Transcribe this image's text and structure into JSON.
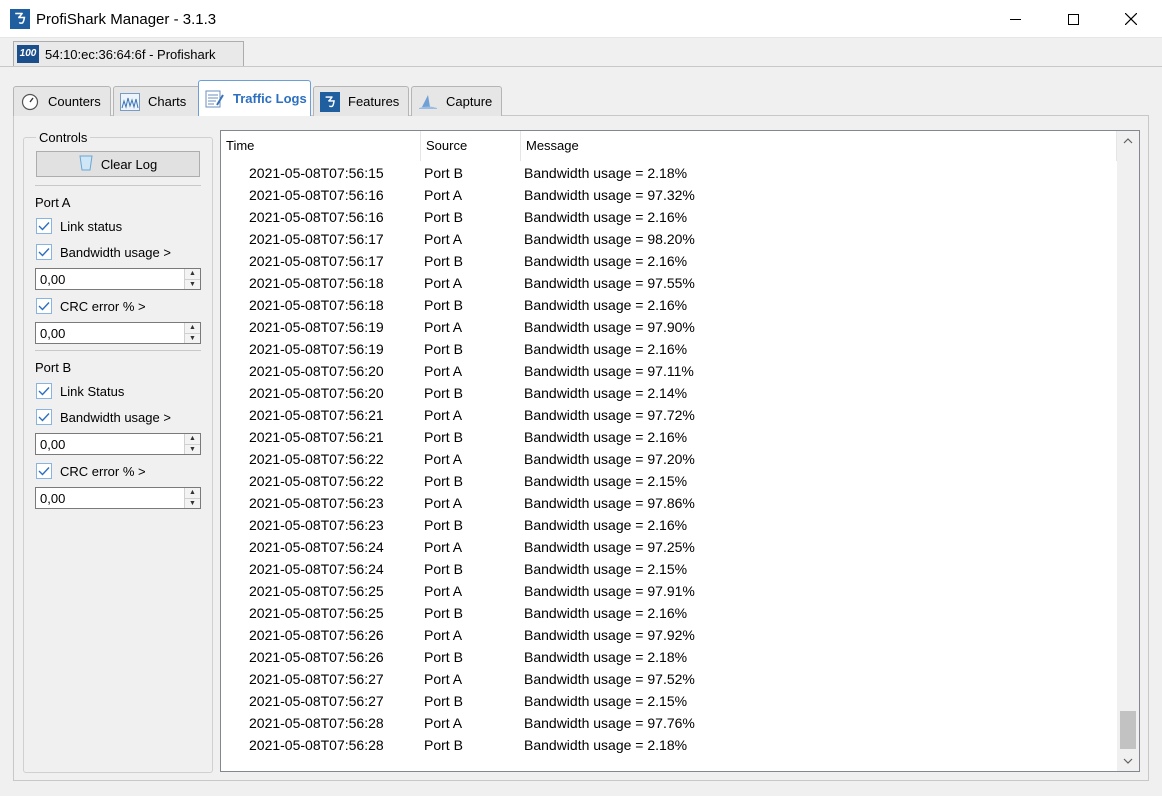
{
  "window": {
    "title": "ProfiShark Manager - 3.1.3",
    "icon": "profishark-logo-icon"
  },
  "device": {
    "badge": "100",
    "label": "54:10:ec:36:64:6f - Profishark"
  },
  "tabs": [
    {
      "label": "Counters",
      "icon": "gauge-icon",
      "active": false
    },
    {
      "label": "Charts",
      "icon": "chart-icon",
      "active": false
    },
    {
      "label": "Traffic Logs",
      "icon": "log-icon",
      "active": true
    },
    {
      "label": "Features",
      "icon": "profishark-logo-icon",
      "active": false
    },
    {
      "label": "Capture",
      "icon": "shark-fin-icon",
      "active": false
    }
  ],
  "controls": {
    "legend": "Controls",
    "clear_label": "Clear Log",
    "port_a": {
      "title": "Port A",
      "link_label": "Link status",
      "link_checked": true,
      "bandwidth_label": "Bandwidth usage >",
      "bandwidth_checked": true,
      "bandwidth_value": "0,00",
      "crc_label": "CRC error % >",
      "crc_checked": true,
      "crc_value": "0,00"
    },
    "port_b": {
      "title": "Port B",
      "link_label": "Link Status",
      "link_checked": true,
      "bandwidth_label": "Bandwidth usage >",
      "bandwidth_checked": true,
      "bandwidth_value": "0,00",
      "crc_label": "CRC error % >",
      "crc_checked": true,
      "crc_value": "0,00"
    }
  },
  "log": {
    "columns": [
      "Time",
      "Source",
      "Message"
    ],
    "rows": [
      [
        "2021-05-08T07:56:15",
        "Port B",
        "Bandwidth usage = 2.18%"
      ],
      [
        "2021-05-08T07:56:16",
        "Port A",
        "Bandwidth usage = 97.32%"
      ],
      [
        "2021-05-08T07:56:16",
        "Port B",
        "Bandwidth usage = 2.16%"
      ],
      [
        "2021-05-08T07:56:17",
        "Port A",
        "Bandwidth usage = 98.20%"
      ],
      [
        "2021-05-08T07:56:17",
        "Port B",
        "Bandwidth usage = 2.16%"
      ],
      [
        "2021-05-08T07:56:18",
        "Port A",
        "Bandwidth usage = 97.55%"
      ],
      [
        "2021-05-08T07:56:18",
        "Port B",
        "Bandwidth usage = 2.16%"
      ],
      [
        "2021-05-08T07:56:19",
        "Port A",
        "Bandwidth usage = 97.90%"
      ],
      [
        "2021-05-08T07:56:19",
        "Port B",
        "Bandwidth usage = 2.16%"
      ],
      [
        "2021-05-08T07:56:20",
        "Port A",
        "Bandwidth usage = 97.11%"
      ],
      [
        "2021-05-08T07:56:20",
        "Port B",
        "Bandwidth usage = 2.14%"
      ],
      [
        "2021-05-08T07:56:21",
        "Port A",
        "Bandwidth usage = 97.72%"
      ],
      [
        "2021-05-08T07:56:21",
        "Port B",
        "Bandwidth usage = 2.16%"
      ],
      [
        "2021-05-08T07:56:22",
        "Port A",
        "Bandwidth usage = 97.20%"
      ],
      [
        "2021-05-08T07:56:22",
        "Port B",
        "Bandwidth usage = 2.15%"
      ],
      [
        "2021-05-08T07:56:23",
        "Port A",
        "Bandwidth usage = 97.86%"
      ],
      [
        "2021-05-08T07:56:23",
        "Port B",
        "Bandwidth usage = 2.16%"
      ],
      [
        "2021-05-08T07:56:24",
        "Port A",
        "Bandwidth usage = 97.25%"
      ],
      [
        "2021-05-08T07:56:24",
        "Port B",
        "Bandwidth usage = 2.15%"
      ],
      [
        "2021-05-08T07:56:25",
        "Port A",
        "Bandwidth usage = 97.91%"
      ],
      [
        "2021-05-08T07:56:25",
        "Port B",
        "Bandwidth usage = 2.16%"
      ],
      [
        "2021-05-08T07:56:26",
        "Port A",
        "Bandwidth usage = 97.92%"
      ],
      [
        "2021-05-08T07:56:26",
        "Port B",
        "Bandwidth usage = 2.18%"
      ],
      [
        "2021-05-08T07:56:27",
        "Port A",
        "Bandwidth usage = 97.52%"
      ],
      [
        "2021-05-08T07:56:27",
        "Port B",
        "Bandwidth usage = 2.15%"
      ],
      [
        "2021-05-08T07:56:28",
        "Port A",
        "Bandwidth usage = 97.76%"
      ],
      [
        "2021-05-08T07:56:28",
        "Port B",
        "Bandwidth usage = 2.18%"
      ]
    ]
  },
  "colors": {
    "accent": "#2c6fc0",
    "brand": "#1f5f9f"
  }
}
